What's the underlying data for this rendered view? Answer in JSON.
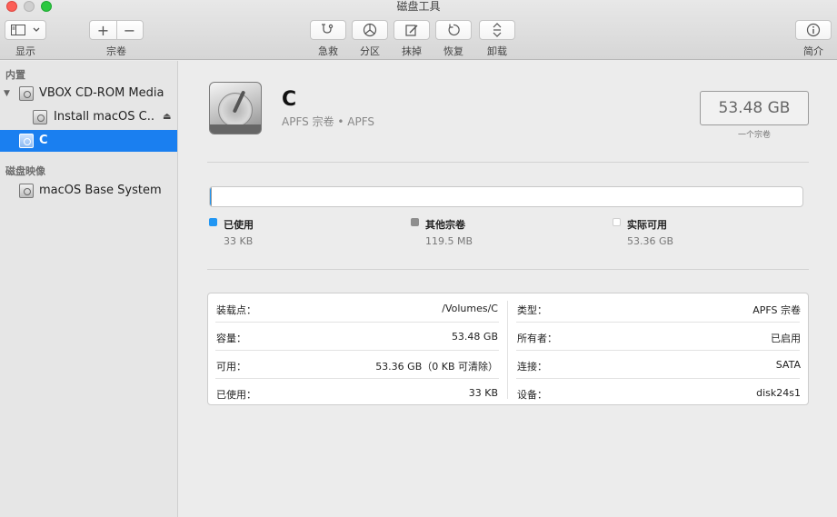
{
  "window": {
    "title": "磁盘工具"
  },
  "toolbar": {
    "view_label": "显示",
    "volume_label": "宗卷",
    "add_symbol": "+",
    "remove_symbol": "−",
    "first_aid_label": "急救",
    "partition_label": "分区",
    "erase_label": "抹掉",
    "restore_label": "恢复",
    "unmount_label": "卸载",
    "info_label": "简介"
  },
  "sidebar": {
    "section_internal": "内置",
    "section_images": "磁盘映像",
    "items": [
      {
        "label": "VBOX CD-ROM Media",
        "icon": "disk-icon"
      },
      {
        "label": "Install macOS C...",
        "icon": "disk-icon"
      },
      {
        "label": "C",
        "icon": "volume-icon",
        "selected": true
      },
      {
        "label": "macOS Base System",
        "icon": "disk-image-icon"
      }
    ]
  },
  "volume": {
    "name": "C",
    "subtitle": "APFS 宗卷 • APFS",
    "size": "53.48 GB",
    "size_caption": "一个宗卷"
  },
  "usage": {
    "used_fraction": 1e-06,
    "other_fraction": 0.0022,
    "legend": [
      {
        "name": "已使用",
        "value": "33 KB",
        "color": "#2196f3"
      },
      {
        "name": "其他宗卷",
        "value": "119.5 MB",
        "color": "#8e8e8e"
      },
      {
        "name": "实际可用",
        "value": "53.36 GB",
        "color": "#ffffff"
      }
    ]
  },
  "info": {
    "left": [
      {
        "key": "装载点：",
        "value": "/Volumes/C"
      },
      {
        "key": "容量：",
        "value": "53.48 GB"
      },
      {
        "key": "可用：",
        "value": "53.36 GB（0 KB 可清除）"
      },
      {
        "key": "已使用：",
        "value": "33 KB"
      }
    ],
    "right": [
      {
        "key": "类型：",
        "value": "APFS 宗卷"
      },
      {
        "key": "所有者：",
        "value": "已启用"
      },
      {
        "key": "连接：",
        "value": "SATA"
      },
      {
        "key": "设备：",
        "value": "disk24s1"
      }
    ]
  }
}
